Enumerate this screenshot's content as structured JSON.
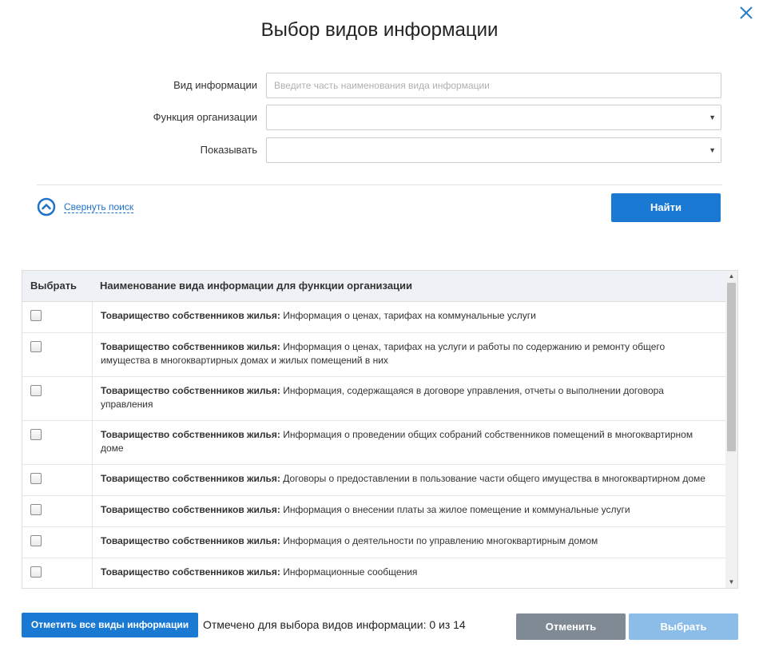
{
  "dialog": {
    "title": "Выбор видов информации",
    "close_icon": "close-icon"
  },
  "form": {
    "info_type": {
      "label": "Вид информации",
      "value": "",
      "placeholder": "Введите часть наименования вида информации"
    },
    "org_function": {
      "label": "Функция организации",
      "selected": ""
    },
    "show": {
      "label": "Показывать",
      "selected": ""
    },
    "collapse_label": "Свернуть поиск",
    "find_label": "Найти"
  },
  "table": {
    "headers": {
      "select": "Выбрать",
      "name": "Наименование вида информации для функции организации"
    },
    "rows": [
      {
        "org": "Товарищество собственников жилья:",
        "text": "Информация о ценах, тарифах на коммунальные услуги"
      },
      {
        "org": "Товарищество собственников жилья:",
        "text": "Информация о ценах, тарифах на услуги и работы по содержанию и ремонту общего имущества в многоквартирных домах и жилых помещений в них"
      },
      {
        "org": "Товарищество собственников жилья:",
        "text": "Информация, содержащаяся в договоре управления, отчеты о выполнении договора управления"
      },
      {
        "org": "Товарищество собственников жилья:",
        "text": "Информация о проведении общих собраний собственников помещений в многоквартирном доме"
      },
      {
        "org": "Товарищество собственников жилья:",
        "text": "Договоры о предоставлении в пользование части общего имущества в многоквартирном доме"
      },
      {
        "org": "Товарищество собственников жилья:",
        "text": "Информация о внесении платы за жилое помещение и коммунальные услуги"
      },
      {
        "org": "Товарищество собственников жилья:",
        "text": "Информация о деятельности по управлению многоквартирным домом"
      },
      {
        "org": "Товарищество собственников жилья:",
        "text": "Информационные сообщения"
      }
    ]
  },
  "footer": {
    "mark_all_label": "Отметить все виды информации",
    "counter": "Отмечено для выбора видов информации: 0 из 14",
    "cancel_label": "Отменить",
    "choose_label": "Выбрать"
  },
  "colors": {
    "primary": "#1a7ad3",
    "disabled_primary": "#8bbde8",
    "secondary": "#7f8a95",
    "link": "#1f72c9",
    "header_bg": "#eef2f6"
  }
}
